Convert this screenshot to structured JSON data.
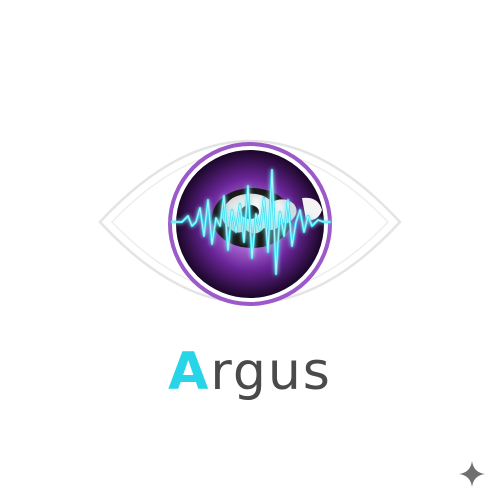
{
  "brand": {
    "name_initial": "A",
    "name_rest": "rgus"
  },
  "icons": {
    "logo": "eye-waveform-logo-icon",
    "corner": "sparkle-icon"
  },
  "colors": {
    "background": "#ffffff",
    "eye_outline": "#e6e6e6",
    "iris_ring": "#9b59c9",
    "iris_dark": "#1a0627",
    "iris_mid": "#6a2598",
    "iris_glow": "#b06bd9",
    "pupil": "#1a1a1a",
    "pupil_highlight": "#ffffff",
    "waveform": "#35e0f2",
    "waveform_glow": "#0aa8c0",
    "initial_accent": "#28d4e8",
    "wordmark_text": "#4a4a4a",
    "sparkle": "#6f6f6f"
  }
}
